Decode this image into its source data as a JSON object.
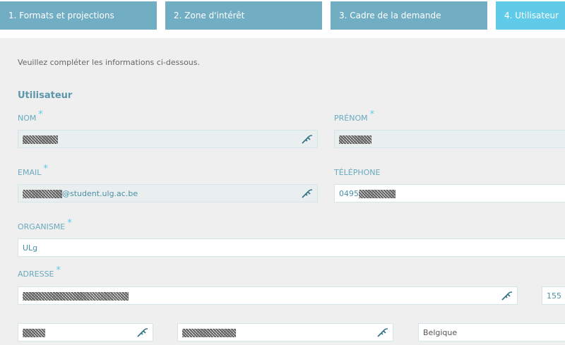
{
  "steps": [
    {
      "label": "1. Formats et projections"
    },
    {
      "label": "2. Zone d'intérêt"
    },
    {
      "label": "3. Cadre de la demande"
    },
    {
      "label": "4. Utilisateur"
    }
  ],
  "intro_text": "Veuillez compléter les informations ci-dessous.",
  "section_title": "Utilisateur",
  "required_mark": "*",
  "fields": {
    "nom": {
      "label": "NOM"
    },
    "prenom": {
      "label": "PRÉNOM"
    },
    "email": {
      "label": "EMAIL",
      "value_suffix": "@student.ulg.ac.be"
    },
    "telephone": {
      "label": "TÉLÉPHONE",
      "value_prefix": "0495"
    },
    "organisme": {
      "label": "ORGANISME",
      "value": "ULg"
    },
    "adresse": {
      "label": "ADRESSE"
    },
    "numero": {
      "value": "155"
    },
    "pays": {
      "value": "Belgique"
    }
  },
  "icons": {
    "autofill": "key-icon"
  },
  "colors": {
    "step_inactive": "#72aec3",
    "step_active": "#5fcbe8",
    "label": "#6aa9be",
    "page_bg": "#efefef"
  }
}
